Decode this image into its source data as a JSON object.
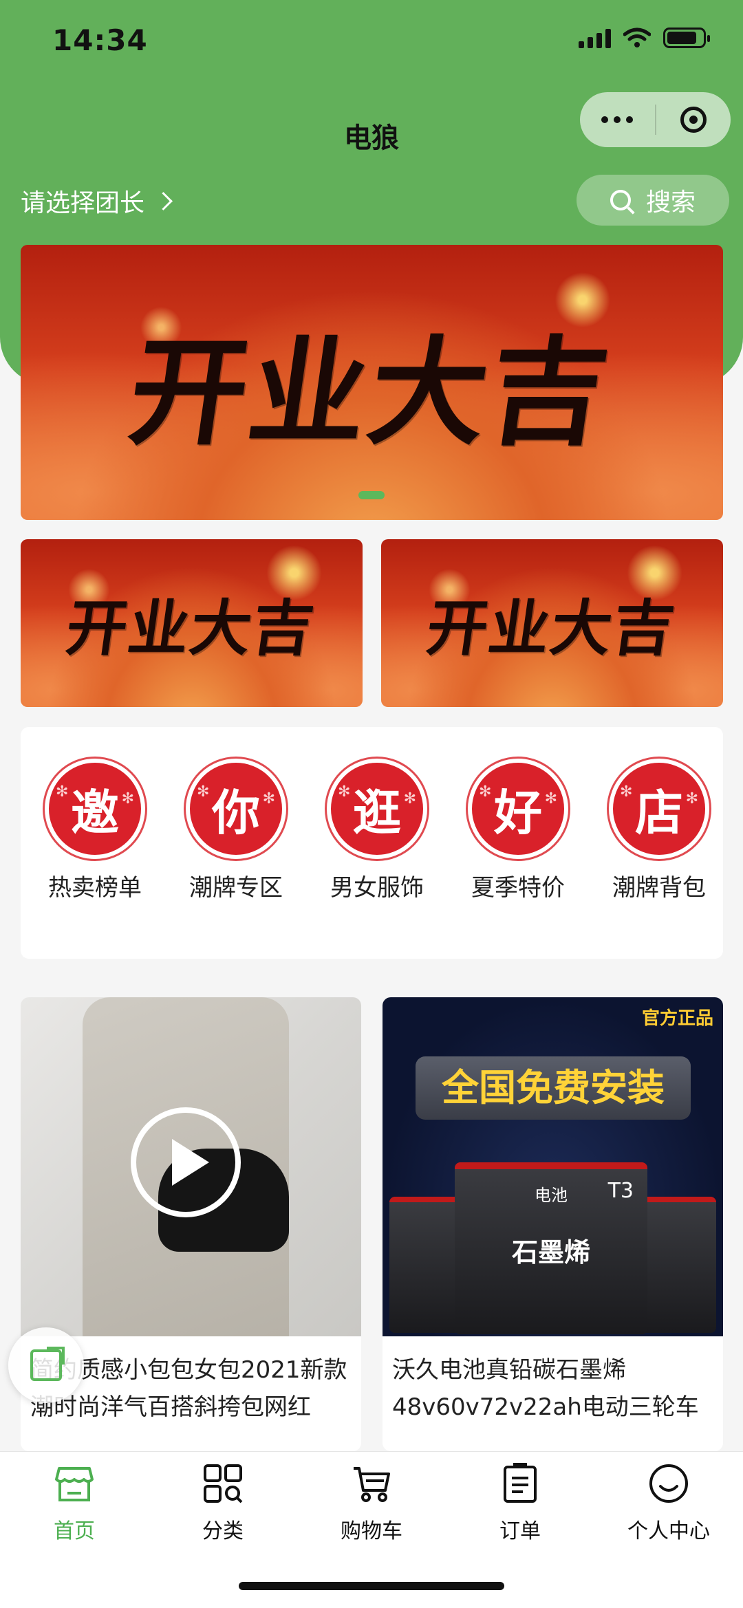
{
  "status_bar": {
    "time": "14:34"
  },
  "nav": {
    "title": "电狼"
  },
  "header": {
    "leader_label": "请选择团长",
    "search_label": "搜索"
  },
  "banners": {
    "main": "开业大吉",
    "sub1": "开业大吉",
    "sub2": "开业大吉"
  },
  "categories": [
    {
      "char": "邀",
      "label": "热卖榜单"
    },
    {
      "char": "你",
      "label": "潮牌专区"
    },
    {
      "char": "逛",
      "label": "男女服饰"
    },
    {
      "char": "好",
      "label": "夏季特价"
    },
    {
      "char": "店",
      "label": "潮牌背包"
    }
  ],
  "products": [
    {
      "title": "简约质感小包包女包2021新款潮时尚洋气百搭斜挎包网红"
    },
    {
      "title": "沃久电池真铅碳石墨烯48v60v72v22ah电动三轮车",
      "badge": "官方正品",
      "promo": "全国免费安装",
      "battery_brand": "电池",
      "battery_model": "T3",
      "battery_name": "石墨烯"
    }
  ],
  "tabs": [
    {
      "label": "首页",
      "icon": "store-icon",
      "active": true
    },
    {
      "label": "分类",
      "icon": "category-grid-icon",
      "active": false
    },
    {
      "label": "购物车",
      "icon": "cart-icon",
      "active": false
    },
    {
      "label": "订单",
      "icon": "order-list-icon",
      "active": false
    },
    {
      "label": "个人中心",
      "icon": "profile-smile-icon",
      "active": false
    }
  ],
  "colors": {
    "brand_green": "#62b05a",
    "active_tab": "#4caf50",
    "badge_red": "#d9212a"
  }
}
